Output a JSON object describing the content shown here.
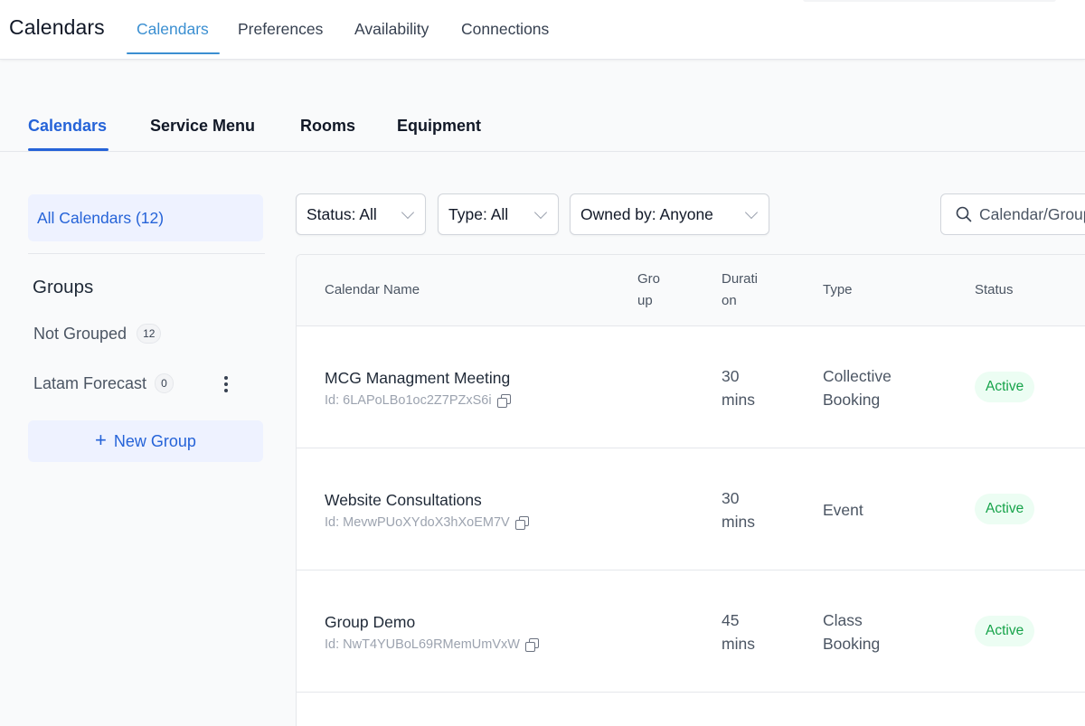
{
  "header": {
    "title": "Calendars",
    "tabs": [
      {
        "label": "Calendars",
        "active": true
      },
      {
        "label": "Preferences",
        "active": false
      },
      {
        "label": "Availability",
        "active": false
      },
      {
        "label": "Connections",
        "active": false
      }
    ]
  },
  "subtabs": [
    {
      "label": "Calendars",
      "active": true
    },
    {
      "label": "Service Menu",
      "active": false
    },
    {
      "label": "Rooms",
      "active": false
    },
    {
      "label": "Equipment",
      "active": false
    }
  ],
  "sidebar": {
    "all_calendars": "All Calendars (12)",
    "groups_heading": "Groups",
    "groups": [
      {
        "label": "Not Grouped",
        "count": "12"
      },
      {
        "label": "Latam Forecast",
        "count": "0"
      }
    ],
    "new_group_label": "New Group",
    "new_group_icon": "plus-icon"
  },
  "filters": {
    "status": "Status: All",
    "type": "Type: All",
    "owned_by": "Owned by: Anyone",
    "search_placeholder": "Calendar/Group"
  },
  "table": {
    "columns": {
      "name": "Calendar Name",
      "group_line1": "Gro",
      "group_line2": "up",
      "duration_line1": "Durati",
      "duration_line2": "on",
      "type": "Type",
      "status": "Status"
    },
    "rows": [
      {
        "name": "MCG Managment Meeting",
        "id": "Id: 6LAPoLBo1oc2Z7PZxS6i",
        "duration_line1": "30",
        "duration_line2": "mins",
        "type_line1": "Collective",
        "type_line2": "Booking",
        "status": "Active"
      },
      {
        "name": "Website Consultations",
        "id": "Id: MevwPUoXYdoX3hXoEM7V",
        "duration_line1": "30",
        "duration_line2": "mins",
        "type_line1": "Event",
        "type_line2": "",
        "status": "Active"
      },
      {
        "name": "Group Demo",
        "id": "Id: NwT4YUBoL69RMemUmVxW",
        "duration_line1": "45",
        "duration_line2": "mins",
        "type_line1": "Class",
        "type_line2": "Booking",
        "status": "Active"
      }
    ]
  },
  "colors": {
    "primary_blue": "#2563d8",
    "header_tab_blue": "#3b8fd1",
    "active_green": "#16a34a",
    "active_badge_bg": "#ecfdf3"
  }
}
